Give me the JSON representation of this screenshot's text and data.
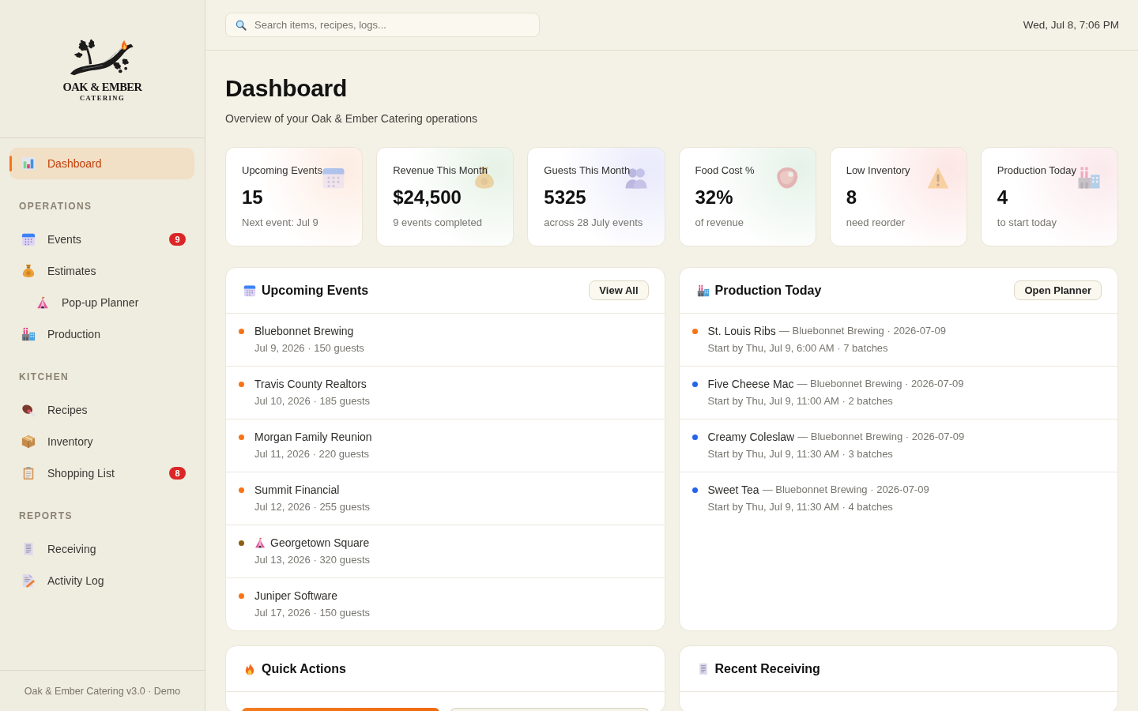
{
  "sidebar": {
    "logo": {
      "title": "OAK & EMBER",
      "subtitle": "CATERING"
    },
    "nav": [
      {
        "label": "Dashboard",
        "selected": true
      }
    ],
    "sections": [
      {
        "title": "OPERATIONS",
        "items": [
          {
            "label": "Events",
            "selected": false,
            "badge": "9"
          },
          {
            "label": "Estimates",
            "selected": false,
            "children": [
              {
                "label": "Pop-up Planner",
                "selected": false
              }
            ]
          },
          {
            "label": "Production",
            "selected": false
          }
        ]
      },
      {
        "title": "KITCHEN",
        "items": [
          {
            "label": "Recipes",
            "selected": false
          },
          {
            "label": "Inventory",
            "selected": false
          },
          {
            "label": "Shopping List",
            "selected": false,
            "badge": "8"
          }
        ]
      },
      {
        "title": "REPORTS",
        "items": [
          {
            "label": "Receiving",
            "selected": false
          },
          {
            "label": "Activity Log",
            "selected": false
          }
        ]
      }
    ],
    "footer": "Oak & Ember Catering v3.0 · Demo"
  },
  "topbar": {
    "search": {
      "placeholder": "Search items, recipes, logs..."
    },
    "datetime": "Wed, Jul 8, 7:06 PM"
  },
  "page": {
    "title": "Dashboard",
    "subtitle": "Overview of your Oak & Ember Catering operations"
  },
  "stats": [
    {
      "label": "Upcoming Events",
      "value": "15",
      "note": "Next event: Jul 9"
    },
    {
      "label": "Revenue This Month",
      "value": "$24,500",
      "note": "9 events completed"
    },
    {
      "label": "Guests This Month",
      "value": "5325",
      "note": "across 28 July events"
    },
    {
      "label": "Food Cost %",
      "value": "32%",
      "note": "of revenue"
    },
    {
      "label": "Low Inventory",
      "value": "8",
      "note": "need reorder"
    },
    {
      "label": "Production Today",
      "value": "4",
      "note": "to start today"
    }
  ],
  "upcoming_events": {
    "title": "Upcoming Events",
    "button": "View All",
    "events": [
      {
        "kind": "event",
        "name": "Bluebonnet Brewing",
        "details": "Jul 9, 2026 · 150 guests",
        "color": "#f97316"
      },
      {
        "kind": "event",
        "name": "Travis County Realtors",
        "details": "Jul 10, 2026 · 185 guests",
        "color": "#f97316"
      },
      {
        "kind": "event",
        "name": "Morgan Family Reunion",
        "details": "Jul 11, 2026 · 220 guests",
        "color": "#f97316"
      },
      {
        "kind": "event",
        "name": "Summit Financial",
        "details": "Jul 12, 2026 · 255 guests",
        "color": "#f97316"
      },
      {
        "kind": "popup",
        "name": "Georgetown Square",
        "details": "Jul 13, 2026 · 320 guests",
        "color": "#8b5e14"
      },
      {
        "kind": "event",
        "name": "Juniper Software",
        "details": "Jul 17, 2026 · 150 guests",
        "color": "#f97316"
      }
    ]
  },
  "production_today": {
    "title": "Production Today",
    "button": "Open Planner",
    "items": [
      {
        "name": "St. Louis Ribs",
        "source": "— Bluebonnet Brewing · 2026-07-09",
        "schedule": "Start by Thu, Jul 9, 6:00 AM · 7 batches",
        "color": "#f97316"
      },
      {
        "name": "Five Cheese Mac",
        "source": "— Bluebonnet Brewing · 2026-07-09",
        "schedule": "Start by Thu, Jul 9, 11:00 AM · 2 batches",
        "color": "#2563eb"
      },
      {
        "name": "Creamy Coleslaw",
        "source": "— Bluebonnet Brewing · 2026-07-09",
        "schedule": "Start by Thu, Jul 9, 11:30 AM · 3 batches",
        "color": "#2563eb"
      },
      {
        "name": "Sweet Tea",
        "source": "— Bluebonnet Brewing · 2026-07-09",
        "schedule": "Start by Thu, Jul 9, 11:30 AM · 4 batches",
        "color": "#2563eb"
      }
    ]
  },
  "quick_actions": {
    "title": "Quick Actions",
    "buttons": [
      {
        "kind": "primary"
      },
      {
        "kind": "secondary"
      }
    ]
  },
  "recent_receiving": {
    "title": "Recent Receiving"
  }
}
